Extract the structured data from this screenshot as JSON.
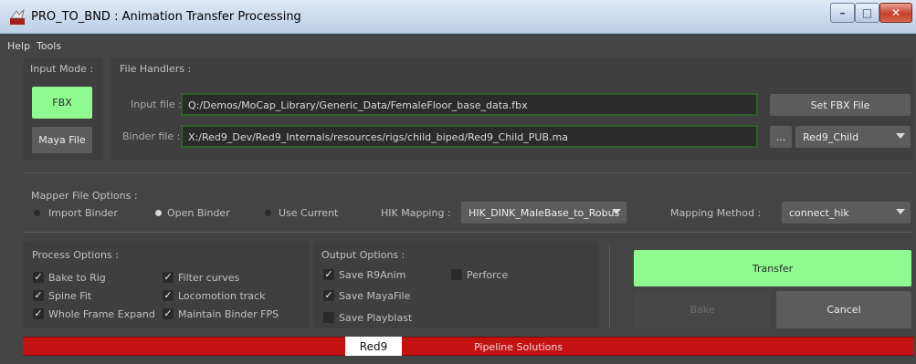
{
  "window": {
    "title": "PRO_TO_BND : Animation Transfer Processing",
    "minimize_glyph": "–",
    "maximize_glyph": "□",
    "close_glyph": "✕"
  },
  "menu": [
    "Help",
    "Tools"
  ],
  "input_mode": {
    "label": "Input Mode :",
    "fbx_button": "FBX",
    "maya_button": "Maya File"
  },
  "file_handlers": {
    "label": "File Handlers :",
    "input_label": "Input file :",
    "input_value": "Q:/Demos/MoCap_Library/Generic_Data/FemaleFloor_base_data.fbx",
    "binder_label": "Binder file :",
    "binder_value": "X:/Red9_Dev/Red9_Internals/resources/rigs/child_biped/Red9_Child_PUB.ma",
    "set_fbx_button": "Set FBX File",
    "browse_button": "...",
    "binder_combo": "Red9_Child"
  },
  "mapper": {
    "label": "Mapper File Options :",
    "import_binder": "Import Binder",
    "open_binder": "Open Binder",
    "use_current": "Use Current",
    "selected": "open_binder",
    "hik_label": "HIK Mapping :",
    "hik_value": "HIK_DINK_MaleBase_to_Robus",
    "method_label": "Mapping Method :",
    "method_value": "connect_hik"
  },
  "process_options": {
    "label": "Process Options :",
    "items": [
      {
        "label": "Bake to Rig",
        "checked": true
      },
      {
        "label": "Spine Fit",
        "checked": true
      },
      {
        "label": "Whole Frame Expand",
        "checked": true
      },
      {
        "label": "Filter curves",
        "checked": true
      },
      {
        "label": "Locomotion track",
        "checked": true
      },
      {
        "label": "Maintain Binder FPS",
        "checked": true
      }
    ]
  },
  "output_options": {
    "label": "Output Options :",
    "items": [
      {
        "label": "Save R9Anim",
        "checked": true
      },
      {
        "label": "Save MayaFile",
        "checked": true
      },
      {
        "label": "Save Playblast",
        "checked": false
      },
      {
        "label": "Perforce",
        "checked": false
      }
    ]
  },
  "actions": {
    "transfer": "Transfer",
    "bake": "Bake",
    "cancel": "Cancel"
  },
  "banner": {
    "logo_text": "Red9",
    "text": "Pipeline Solutions"
  },
  "check_glyph": "✓",
  "colors": {
    "green_button": "#8ffa8f",
    "field_border": "#2f5f2c",
    "banner_red": "#c41212"
  }
}
